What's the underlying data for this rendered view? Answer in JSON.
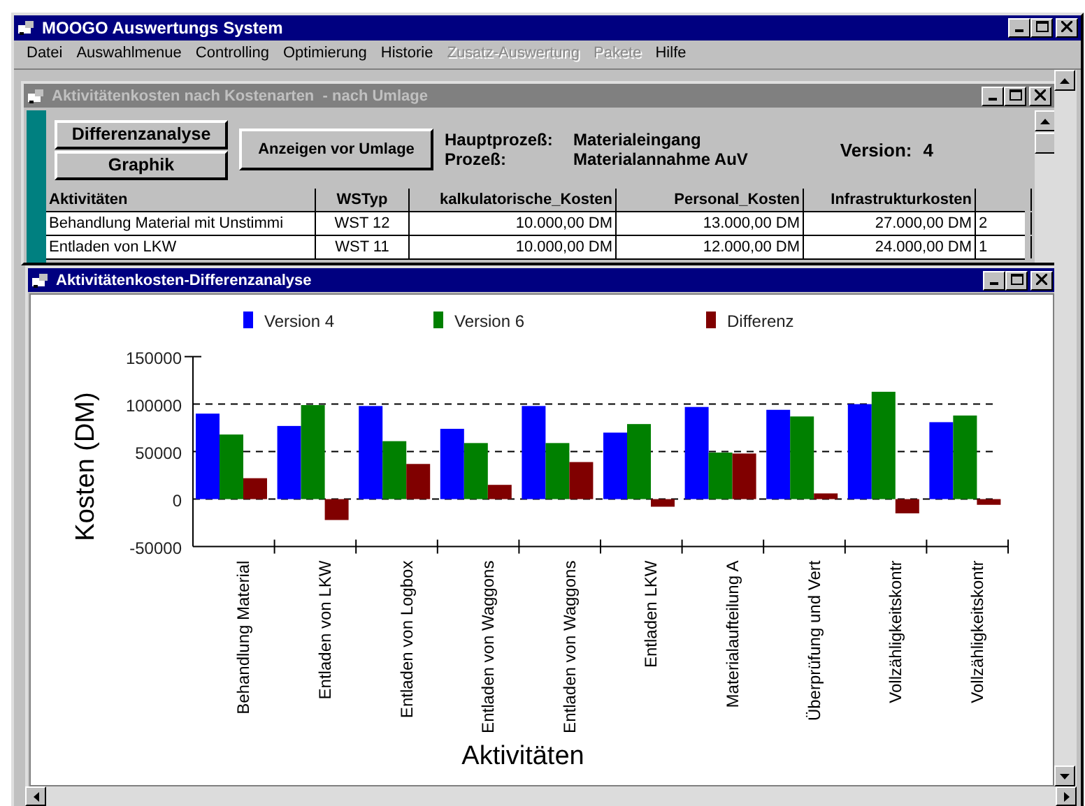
{
  "window": {
    "title": "MOOGO Auswertungs System"
  },
  "menu": [
    {
      "label": "Datei",
      "disabled": false
    },
    {
      "label": "Auswahlmenue",
      "disabled": false
    },
    {
      "label": "Controlling",
      "disabled": false
    },
    {
      "label": "Optimierung",
      "disabled": false
    },
    {
      "label": "Historie",
      "disabled": false
    },
    {
      "label": "Zusatz-Auswertung",
      "disabled": true
    },
    {
      "label": "Pakete",
      "disabled": true
    },
    {
      "label": "Hilfe",
      "disabled": false
    }
  ],
  "cost_window": {
    "title": "Aktivitätenkosten nach Kostenarten  - nach Umlage",
    "active": false,
    "buttons": [
      {
        "label": "Differenzanalyse"
      },
      {
        "label": "Graphik"
      }
    ],
    "umlage_button": "Anzeigen vor Umlage",
    "info": [
      {
        "label": "Hauptprozeß:",
        "value": "Materialeingang"
      },
      {
        "label": "Prozeß:",
        "value": "Materialannahme AuV"
      }
    ],
    "version_label": "Version:",
    "version": "4",
    "table": {
      "columns": [
        "Aktivitäten",
        "WSTyp",
        "kalkulatorische_Kosten",
        "Personal_Kosten",
        "Infrastrukturkosten",
        ""
      ],
      "rows": [
        [
          "Behandlung Material mit Unstimmi",
          "WST 12",
          "10.000,00 DM",
          "13.000,00 DM",
          "27.000,00 DM",
          "2"
        ],
        [
          "Entladen von LKW",
          "WST 11",
          "10.000,00 DM",
          "12.000,00 DM",
          "24.000,00 DM",
          "1"
        ]
      ]
    }
  },
  "chart_window": {
    "title": "Aktivitätenkosten-Differenzanalyse",
    "active": true,
    "chart_data": {
      "type": "bar",
      "xlabel": "Aktivitäten",
      "ylabel": "Kosten (DM)",
      "categories": [
        "Behandlung Material",
        "Entladen von LKW",
        "Entladen von Logbox",
        "Entladen von Waggons",
        "Entladen von Waggons",
        "Entladen LKW",
        "Materialaufteilung A",
        "Überprüfung und Vert",
        "Vollzähligkeitskontr",
        "Vollzähligkeitskontr"
      ],
      "series": [
        {
          "name": "Version 4",
          "color": "#0000ff",
          "values": [
            90000,
            77000,
            98000,
            74000,
            98000,
            70000,
            97000,
            94000,
            100000,
            81000
          ]
        },
        {
          "name": "Version 6",
          "color": "#008000",
          "values": [
            68000,
            99000,
            61000,
            59000,
            59000,
            79000,
            49000,
            87000,
            113000,
            88000
          ]
        },
        {
          "name": "Differenz",
          "color": "#800000",
          "values": [
            22000,
            -22000,
            37000,
            15000,
            39000,
            -8000,
            48000,
            6000,
            -15000,
            -6000
          ]
        }
      ],
      "legend": true,
      "grid": {
        "y": true
      },
      "ylim": [
        -50000,
        150000
      ],
      "yticks": [
        -50000,
        0,
        50000,
        100000,
        150000
      ]
    }
  }
}
